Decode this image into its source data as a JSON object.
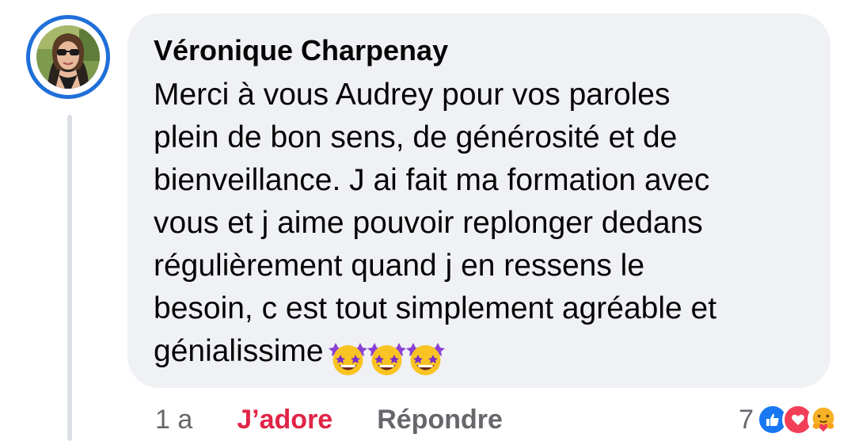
{
  "comment": {
    "author": "Véronique Charpenay",
    "text": "Merci à vous Audrey pour vos paroles\nplein de bon sens, de générosité et de\nbienveillance. J ai fait ma formation avec\nvous et j aime pouvoir replonger dedans\nrégulièrement quand j en ressens le\nbesoin, c est tout simplement agréable et\ngénialissime",
    "emojis": [
      "star-struck-icon",
      "star-struck-icon",
      "star-struck-icon"
    ]
  },
  "actions": {
    "timestamp": "1 a",
    "love_label": "J’adore",
    "reply_label": "Répondre"
  },
  "reactions": {
    "count": "7",
    "icons": [
      "like-icon",
      "love-icon",
      "care-icon"
    ]
  },
  "colors": {
    "avatar_ring": "#1f6fd8",
    "bubble": "#eff1f4",
    "love_action": "#e02447",
    "secondary_text": "#65676b",
    "like": "#1877f2",
    "love": "#f33e58",
    "care": "#f7b125"
  }
}
